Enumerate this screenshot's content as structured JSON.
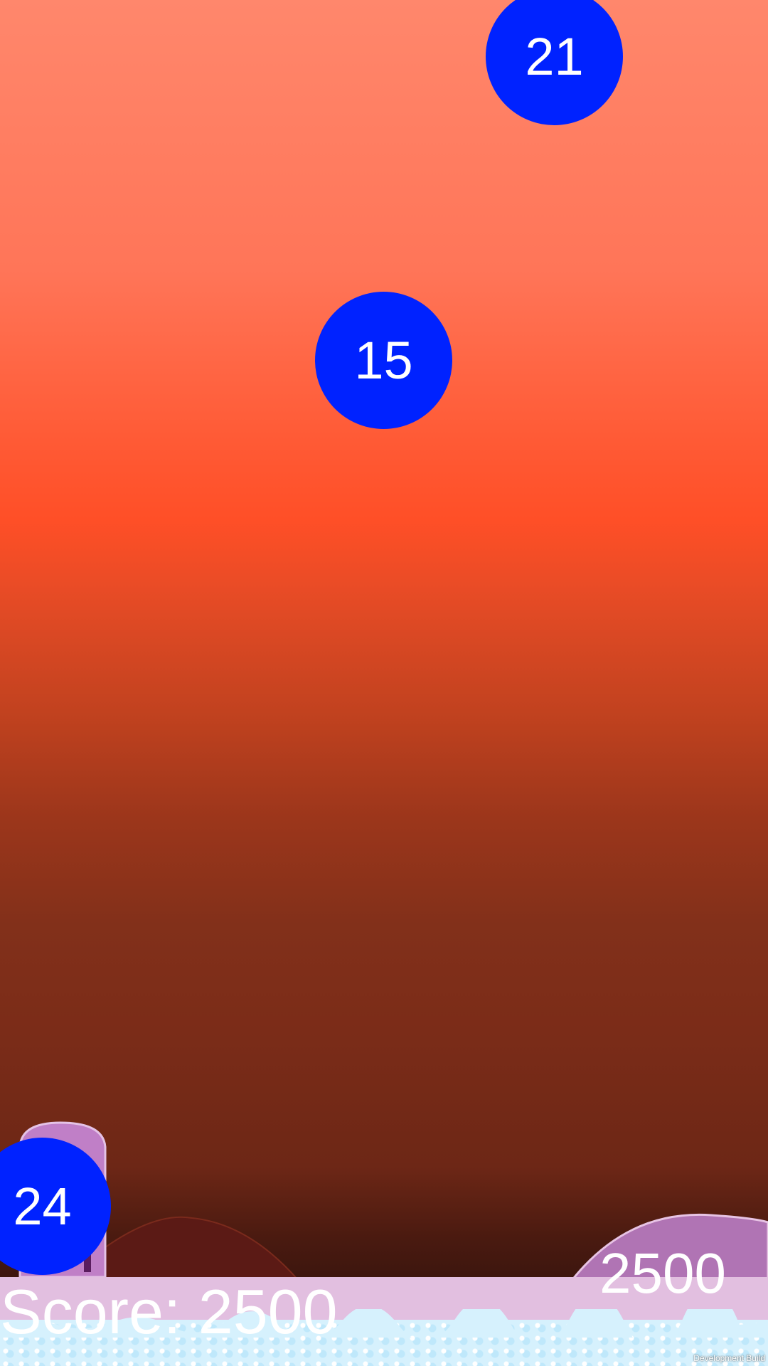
{
  "bubbles": [
    {
      "id": "bubble-21",
      "value": "21"
    },
    {
      "id": "bubble-15",
      "value": "15"
    },
    {
      "id": "bubble-24",
      "value": "24"
    }
  ],
  "hud": {
    "score_text": "Score: 2500",
    "points_popup": "2500",
    "build_label": "Development Build"
  },
  "colors": {
    "bubble": "#0022ff",
    "sky_top": "#ff876c",
    "sky_mid": "#ff4f27",
    "sky_bottom": "#3a150e",
    "ground": "#e2bfe0",
    "ice": "#d6f1fd"
  }
}
